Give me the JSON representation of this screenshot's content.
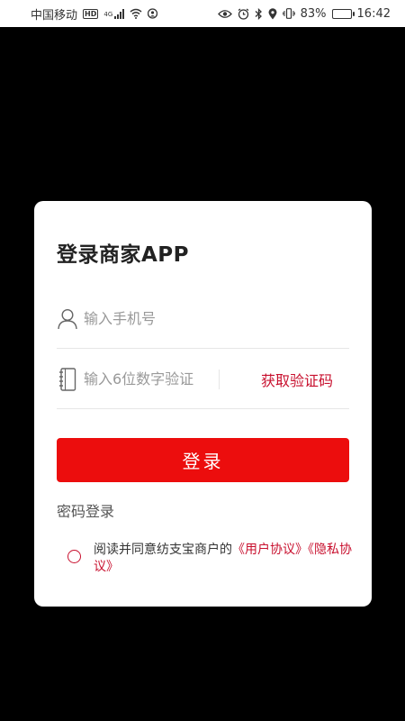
{
  "status_bar": {
    "carrier": "中国移动",
    "hd": "HD",
    "network": "4G",
    "battery_percent": "83%",
    "battery_level": 0.83,
    "time": "16:42"
  },
  "login": {
    "title": "登录商家APP",
    "phone_placeholder": "输入手机号",
    "code_placeholder": "输入6位数字验证",
    "get_code_label": "获取验证码",
    "login_button": "登录",
    "password_login": "密码登录",
    "agreement_prefix": "阅读并同意纺支宝商户的",
    "user_agreement": "《用户协议》",
    "privacy_policy": "《隐私协议》"
  },
  "colors": {
    "accent": "#ec0d0d",
    "link": "#c8102e",
    "background": "#000000"
  }
}
